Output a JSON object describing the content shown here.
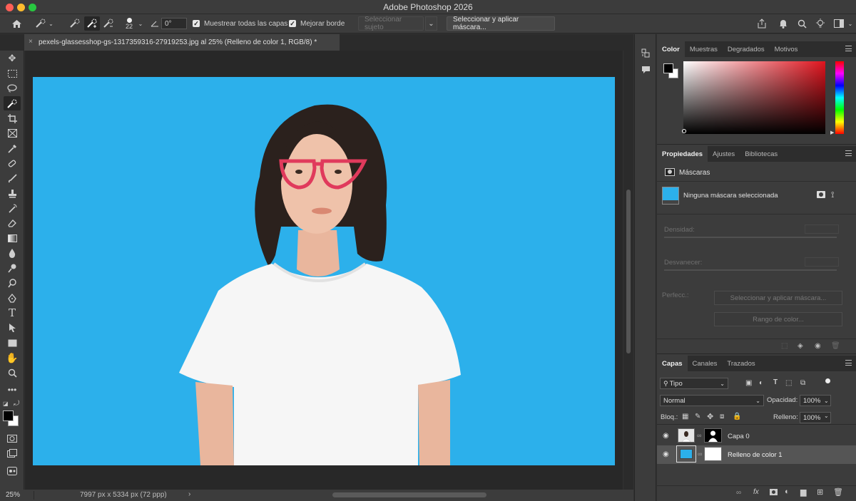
{
  "app": {
    "title": "Adobe Photoshop 2026"
  },
  "options": {
    "brush_size": "22",
    "angle": "0°",
    "sample_all_layers": "Muestrear todas las capas",
    "enhance_edge": "Mejorar borde",
    "select_subject": "Seleccionar sujeto",
    "select_and_mask": "Seleccionar y aplicar máscara..."
  },
  "document": {
    "tab_title": "pexels-glassesshop-gs-1317359316-27919253.jpg al 25% (Relleno de color 1, RGB/8) *",
    "zoom": "25%",
    "dimensions": "7997 px x 5334 px (72 ppp)",
    "background_color": "#2cb0eb"
  },
  "color_panel": {
    "tabs": [
      "Color",
      "Muestras",
      "Degradados",
      "Motivos"
    ],
    "hue_color": "#e0141e"
  },
  "properties_panel": {
    "tabs": [
      "Propiedades",
      "Ajustes",
      "Bibliotecas"
    ],
    "section": "Máscaras",
    "no_mask": "Ninguna máscara seleccionada",
    "density_label": "Densidad:",
    "feather_label": "Desvanecer:",
    "refine_label": "Perfecc.:",
    "select_mask_btn": "Seleccionar y aplicar máscara...",
    "color_range_btn": "Rango de color..."
  },
  "layers_panel": {
    "tabs": [
      "Capas",
      "Canales",
      "Trazados"
    ],
    "filter": "Tipo",
    "blend_mode": "Normal",
    "opacity_label": "Opacidad:",
    "opacity_value": "100%",
    "lock_label": "Bloq.:",
    "fill_label": "Relleno:",
    "fill_value": "100%",
    "layers": [
      {
        "name": "Capa 0"
      },
      {
        "name": "Relleno de color 1"
      }
    ]
  }
}
